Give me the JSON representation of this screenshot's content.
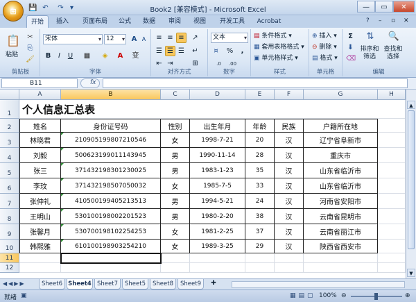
{
  "window": {
    "title": "Book2 [兼容模式] - Microsoft Excel",
    "controls": [
      "—",
      "▭",
      "✕"
    ],
    "inner_controls": [
      "?",
      "–",
      "▫",
      "✕"
    ]
  },
  "office_button": "⊞",
  "qat": {
    "save": "💾",
    "undo": "↶",
    "redo": "↷",
    "more": "▾"
  },
  "ribbon_tabs": [
    "开始",
    "插入",
    "页面布局",
    "公式",
    "数据",
    "审阅",
    "视图",
    "开发工具",
    "Acrobat"
  ],
  "ribbon": {
    "clipboard": {
      "label": "剪贴板",
      "paste": "粘贴"
    },
    "font": {
      "label": "字体",
      "name": "宋体",
      "size": "12",
      "bold": "B",
      "italic": "I",
      "underline": "U",
      "grow": "A",
      "shrink": "A",
      "fontcolor": "A"
    },
    "alignment": {
      "label": "对齐方式"
    },
    "number": {
      "label": "数字",
      "format": "文本",
      "percent": "%",
      "comma": ","
    },
    "styles": {
      "label": "样式",
      "conditional": "条件格式",
      "table": "套用表格格式",
      "cell": "单元格样式"
    },
    "cells": {
      "label": "单元格",
      "insert": "插入",
      "delete": "删除",
      "format": "格式"
    },
    "editing": {
      "label": "编辑",
      "sum": "Σ",
      "sort": "排序和\n筛选",
      "find": "查找和\n选择"
    }
  },
  "formula_bar": {
    "name_box": "B11",
    "fx": "fx"
  },
  "columns": [
    "A",
    "B",
    "C",
    "D",
    "E",
    "F",
    "G",
    "H"
  ],
  "rows": [
    "1",
    "2",
    "3",
    "4",
    "5",
    "6",
    "7",
    "8",
    "9",
    "10",
    "11",
    "12"
  ],
  "table": {
    "title": "个人信息汇总表",
    "headers": [
      "姓名",
      "身份证号码",
      "性别",
      "出生年月",
      "年龄",
      "民族",
      "户籍所在地"
    ],
    "records": [
      [
        "林晓君",
        "210905199807210546",
        "女",
        "1998-7-21",
        "20",
        "汉",
        "辽宁省阜新市"
      ],
      [
        "刘毅",
        "500623199011143945",
        "男",
        "1990-11-14",
        "28",
        "汉",
        "重庆市"
      ],
      [
        "张三",
        "371432198301230025",
        "男",
        "1983-1-23",
        "35",
        "汉",
        "山东省临沂市"
      ],
      [
        "李玟",
        "371432198507050032",
        "女",
        "1985-7-5",
        "33",
        "汉",
        "山东省临沂市"
      ],
      [
        "张仲礼",
        "410500199405213513",
        "男",
        "1994-5-21",
        "24",
        "汉",
        "河南省安阳市"
      ],
      [
        "王明山",
        "530100198002201523",
        "男",
        "1980-2-20",
        "38",
        "汉",
        "云南省昆明市"
      ],
      [
        "张馨月",
        "530700198102254253",
        "女",
        "1981-2-25",
        "37",
        "汉",
        "云南省丽江市"
      ],
      [
        "韩熙雅",
        "610100198903254210",
        "女",
        "1989-3-25",
        "29",
        "汉",
        "陕西省西安市"
      ]
    ]
  },
  "sheets": [
    "Sheet6",
    "Sheet4",
    "Sheet7",
    "Sheet5",
    "Sheet8",
    "Sheet9"
  ],
  "active_sheet": "Sheet4",
  "status": {
    "ready": "就绪",
    "zoom": "100%"
  }
}
